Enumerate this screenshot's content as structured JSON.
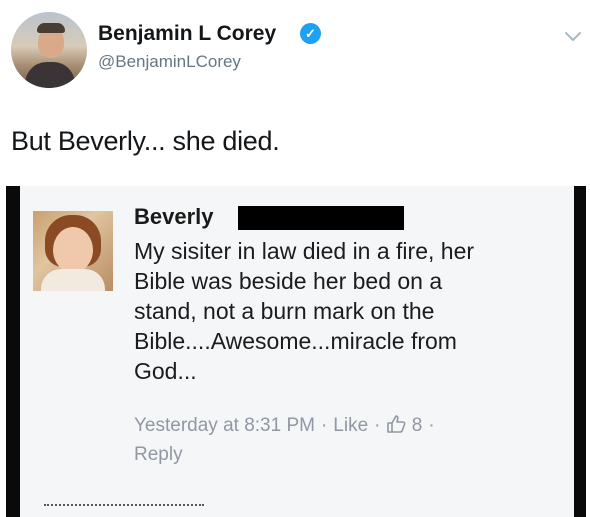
{
  "tweet": {
    "author": {
      "display_name": "Benjamin L Corey",
      "handle": "@BenjaminLCorey",
      "verified": true
    },
    "text": "But Beverly... she died."
  },
  "embedded_post": {
    "author_name": "Beverly",
    "body_lines": [
      "My sisiter in law died in a fire, her",
      "Bible was beside her bed on a",
      "stand, not a burn mark on the",
      "Bible....Awesome...miracle from",
      "God..."
    ],
    "timestamp": "Yesterday at 8:31 PM",
    "like_label": "Like",
    "like_count": "8",
    "reply_label": "Reply",
    "separator": "·"
  },
  "colors": {
    "verified_blue": "#1da1f2",
    "handle_gray": "#657786",
    "meta_gray": "#9197a3"
  },
  "icons": [
    "chevron-down-icon",
    "verified-badge-icon",
    "thumbs-up-icon"
  ]
}
